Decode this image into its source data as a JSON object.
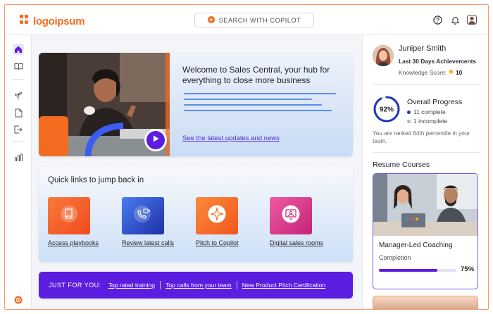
{
  "header": {
    "logo_text": "logoipsum",
    "search_label": "SEARCH WITH COPILOT",
    "icons": [
      "help-icon",
      "bell-icon",
      "profile-icon"
    ]
  },
  "sidebar": {
    "icons": [
      "home-icon",
      "book-icon",
      "plant-icon",
      "document-icon",
      "export-icon",
      "bar-chart-icon",
      "copilot-icon"
    ]
  },
  "hero": {
    "title": "Welcome to Sales Central, your hub for everything to close more business",
    "link": "See the latest updates and news"
  },
  "quick_links": {
    "title": "Quick links to jump back in",
    "items": [
      {
        "label": "Access playbooks",
        "icon": "book-icon",
        "color": "#f5562a"
      },
      {
        "label": "Review latest calls",
        "icon": "phone-video-icon",
        "color": "#2a52c9"
      },
      {
        "label": "Pitch to Copilot",
        "icon": "sparkle-icon",
        "color": "#f36b21"
      },
      {
        "label": "Digital sales rooms",
        "icon": "presenter-icon",
        "color": "#d93a8c"
      }
    ]
  },
  "just_for_you": {
    "label": "JUST FOR YOU:",
    "links": [
      "Top rated training",
      "Top calls from your team",
      "New Product Pitch Certification"
    ]
  },
  "user": {
    "name": "Juniper Smith",
    "subtitle": "Last 30 Days Achievements",
    "score_label": "Knowledge Score:",
    "score_value": "10"
  },
  "progress": {
    "percent_text": "92%",
    "percent": 0.92,
    "title": "Overall Progress",
    "complete": "11 complete",
    "incomplete": "1 incomplete",
    "rank_text": "You are ranked 64th percentile in your team."
  },
  "resume": {
    "title": "Resume Courses",
    "course_title": "Manager-Led Coaching",
    "course_status": "Completion",
    "course_pct_text": "75%",
    "course_pct": 0.75
  },
  "colors": {
    "accent": "#5b1ee0",
    "brand": "#f36b21"
  }
}
